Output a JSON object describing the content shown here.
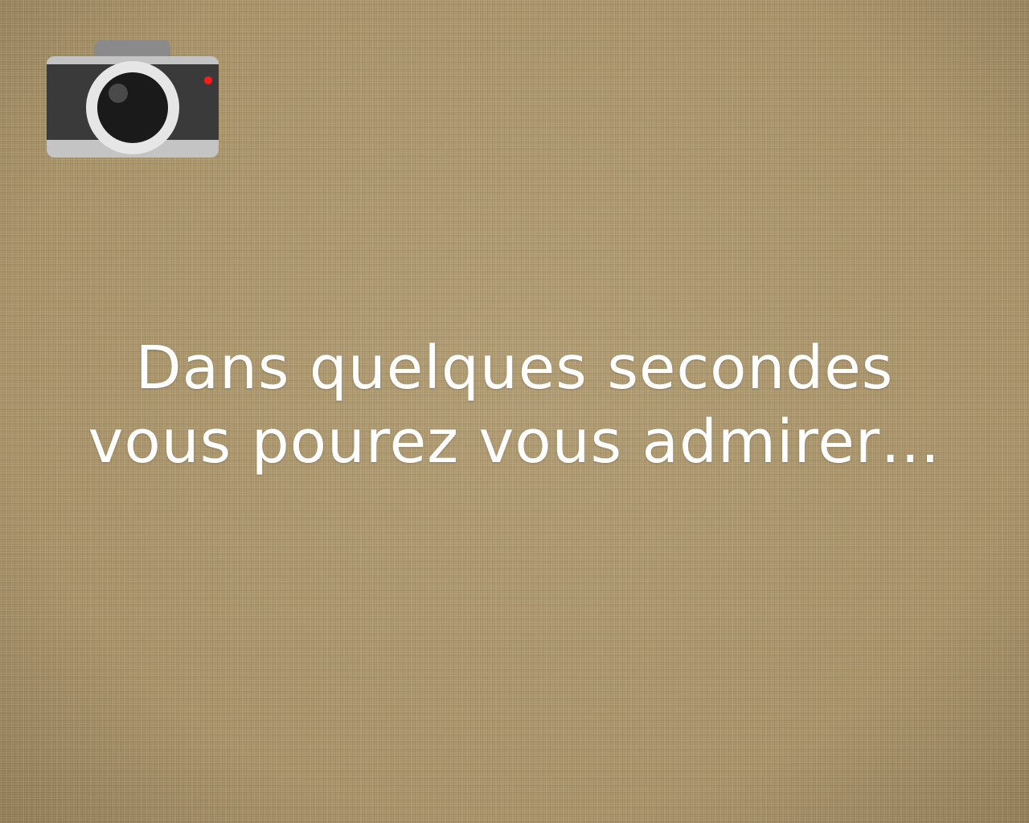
{
  "slide": {
    "icon": "camera-icon",
    "message_lines": [
      "Dans quelques secondes",
      "vous pourez vous admirer…"
    ]
  },
  "colors": {
    "background": "#a8936a",
    "text": "#ffffff",
    "camera_body": "#3a3a3a",
    "camera_top": "#8a8a8a",
    "camera_bottom": "#c4c4c4",
    "lens_ring": "#e6e6e6",
    "lens": "#1a1a1a",
    "indicator": "#ff1a1a"
  }
}
